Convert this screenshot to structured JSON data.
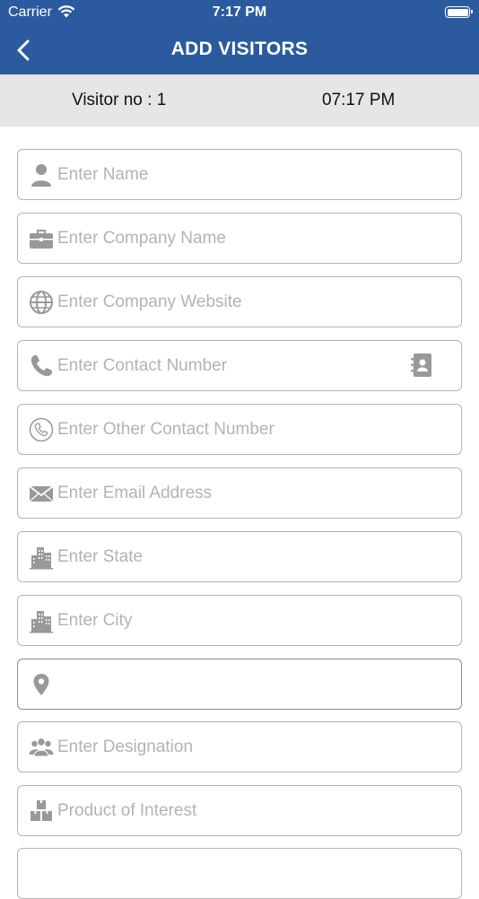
{
  "status_bar": {
    "carrier": "Carrier",
    "time": "7:17 PM"
  },
  "header": {
    "title": "ADD VISITORS",
    "back_icon": "chevron-left-icon",
    "color": "#2b5b9e"
  },
  "info": {
    "visitor_no": "Visitor no : 1",
    "time": "07:17 PM"
  },
  "form": {
    "name": {
      "placeholder": "Enter Name",
      "value": "",
      "icon": "person-icon"
    },
    "company_name": {
      "placeholder": "Enter Company Name",
      "value": "",
      "icon": "briefcase-icon"
    },
    "company_website": {
      "placeholder": "Enter Company Website",
      "value": "",
      "icon": "globe-icon"
    },
    "contact_number": {
      "placeholder": "Enter Contact Number",
      "value": "",
      "icon": "phone-icon",
      "action_icon": "contact-book-icon"
    },
    "other_contact_number": {
      "placeholder": "Enter Other Contact Number",
      "value": "",
      "icon": "phone-circle-icon"
    },
    "email": {
      "placeholder": "Enter Email Address",
      "value": "",
      "icon": "envelope-icon"
    },
    "state": {
      "placeholder": "Enter State",
      "value": "",
      "icon": "buildings-icon"
    },
    "city": {
      "placeholder": "Enter City",
      "value": "",
      "icon": "buildings-icon"
    },
    "location": {
      "placeholder": "",
      "value": "",
      "icon": "location-pin-icon"
    },
    "designation": {
      "placeholder": "Enter Designation",
      "value": "",
      "icon": "group-icon"
    },
    "product_interest": {
      "placeholder": "Product of Interest",
      "value": "",
      "icon": "boxes-icon"
    }
  }
}
